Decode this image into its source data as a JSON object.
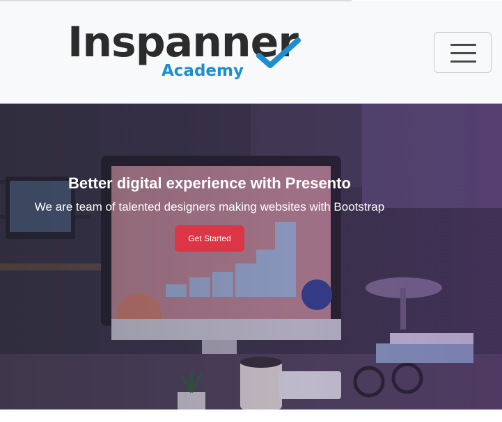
{
  "brand": {
    "name": "Inspanner",
    "tagline": "Academy",
    "accent": "#1d8ed2",
    "text_color": "#2c2c2c"
  },
  "navbar": {
    "toggler_icon": "hamburger-icon",
    "background": "#f8f9fa"
  },
  "hero": {
    "title": "Better digital experience with Presento",
    "subtitle": "We are team of talented designers making websites with Bootstrap",
    "cta_label": "Get Started",
    "cta_color": "#dc3545"
  }
}
